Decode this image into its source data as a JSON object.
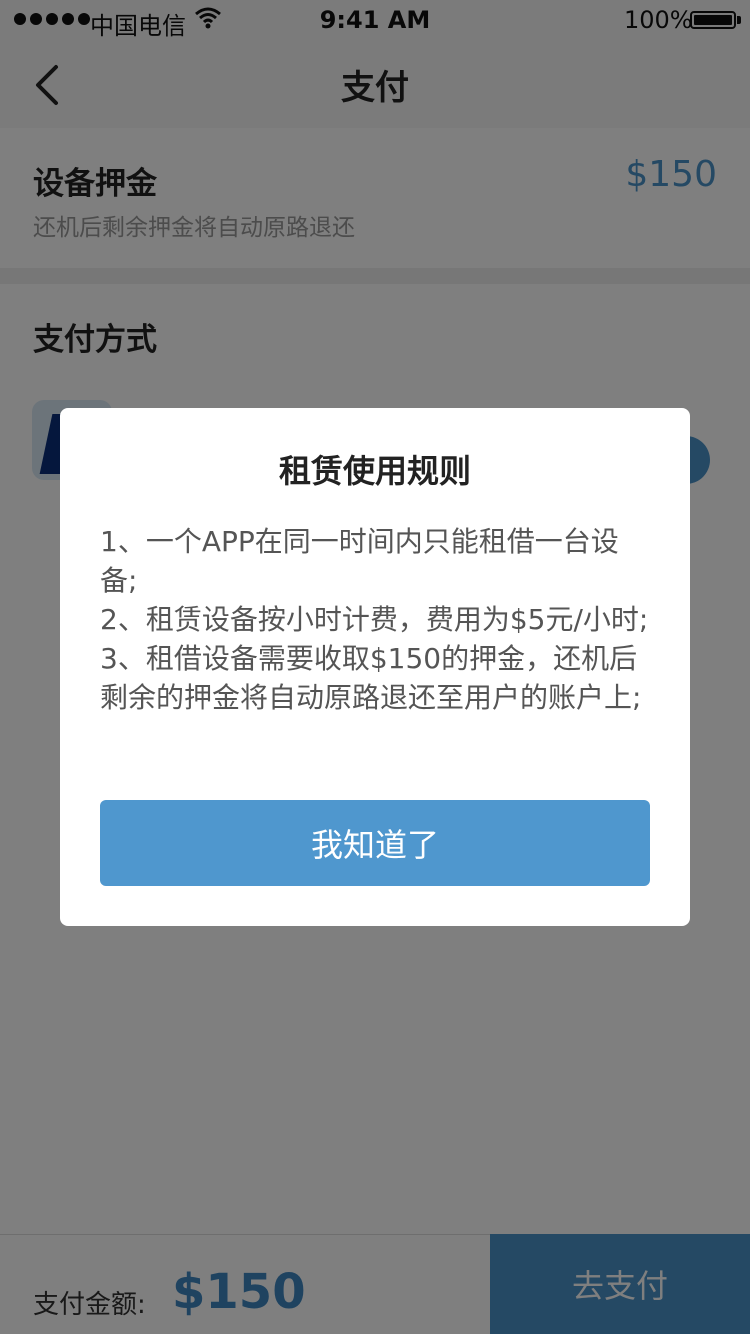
{
  "status_bar": {
    "carrier": "中国电信",
    "time": "9:41 AM",
    "battery": "100%"
  },
  "nav": {
    "title": "支付",
    "back_icon": "chevron-left-icon"
  },
  "deposit": {
    "title": "设备押金",
    "amount": "$150",
    "note": "还机后剩余押金将自动原路退还"
  },
  "payment": {
    "section_title": "支付方式",
    "method_icon": "paypal-logo-icon",
    "selected_icon": "check-circle-icon"
  },
  "bottom": {
    "total_label": "支付金额:",
    "total_amount": "$150",
    "pay_button": "去支付"
  },
  "modal": {
    "title": "租赁使用规则",
    "rules": [
      "1、一个APP在同一时间内只能租借一台设备;",
      "2、租赁设备按小时计费，费用为$5元/小时;",
      "3、租借设备需要收取$150的押金，还机后剩余的押金将自动原路退还至用户的账户上;"
    ],
    "confirm_button": "我知道了"
  },
  "colors": {
    "accent": "#4a93c9",
    "overlay": "rgba(0,0,0,0.5)"
  }
}
